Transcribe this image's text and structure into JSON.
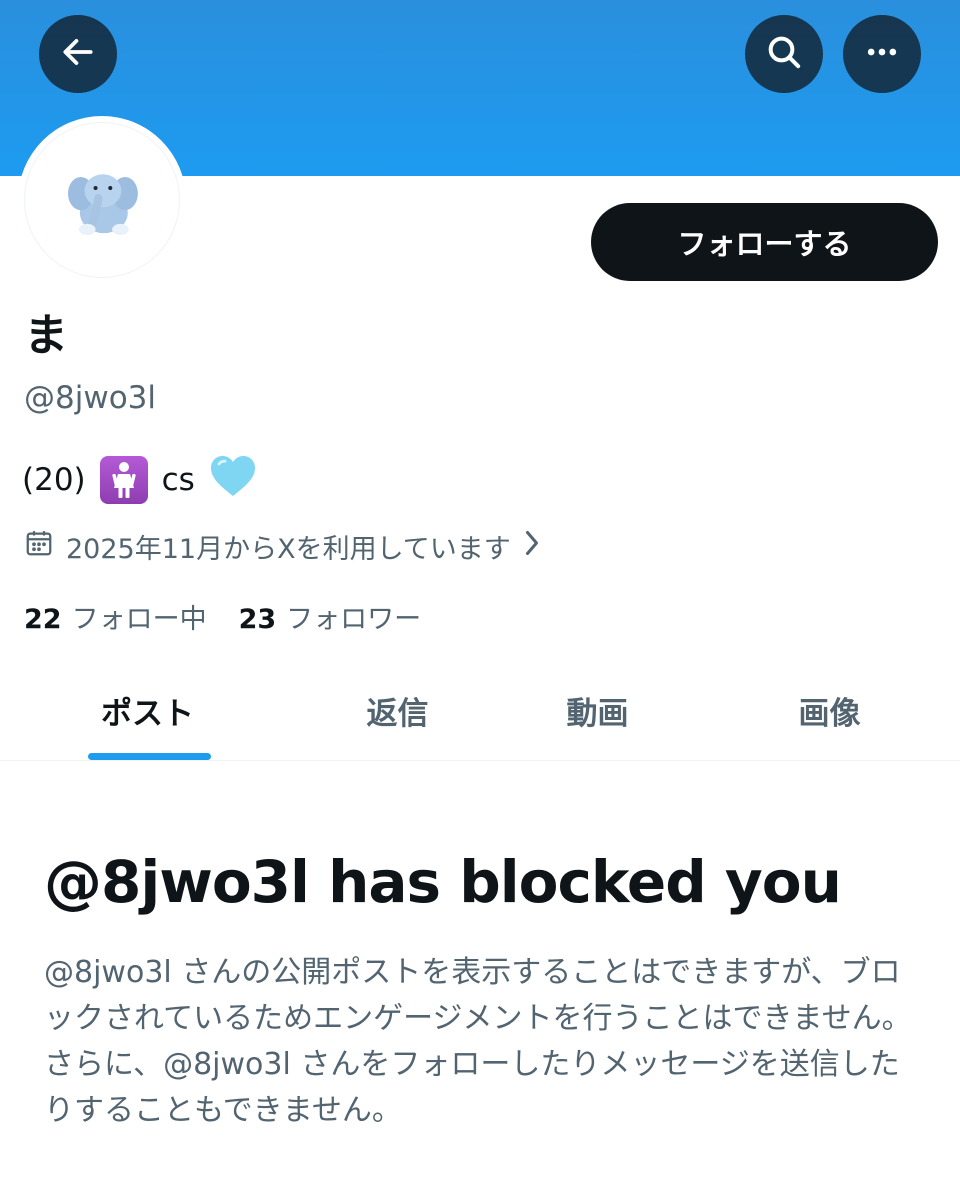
{
  "colors": {
    "banner": "#1d9bf0",
    "accent": "#1d9bf0",
    "text": "#0f1419",
    "secondary": "#536471",
    "button": "#0f1419"
  },
  "header": {
    "back_icon": "arrow-left-icon",
    "search_icon": "search-icon",
    "more_icon": "more-horizontal-icon"
  },
  "profile": {
    "avatar": "elephant-plush-avatar",
    "follow_label": "フォローする",
    "display_name": "ま",
    "handle": "@8jwo3l",
    "bio": {
      "age": "(20)",
      "emoji_1": "womens-restroom-emoji",
      "text": "cs",
      "emoji_2": "light-blue-heart-emoji"
    },
    "joined": {
      "icon": "calendar-icon",
      "text": "2025年11月からXを利用しています",
      "chevron": "chevron-right-icon"
    },
    "stats": {
      "following_count": "22",
      "following_label": "フォロー中",
      "followers_count": "23",
      "followers_label": "フォロワー"
    }
  },
  "tabs": [
    {
      "label": "ポスト",
      "active": true
    },
    {
      "label": "返信",
      "active": false
    },
    {
      "label": "動画",
      "active": false
    },
    {
      "label": "画像",
      "active": false
    }
  ],
  "blocked": {
    "title": "@8jwo3l has blocked you",
    "description": "@8jwo3l さんの公開ポストを表示することはできますが、ブロックされているためエンゲージメントを行うことはできません。さらに、@8jwo3l さんをフォローしたりメッセージを送信したりすることもできません。"
  }
}
